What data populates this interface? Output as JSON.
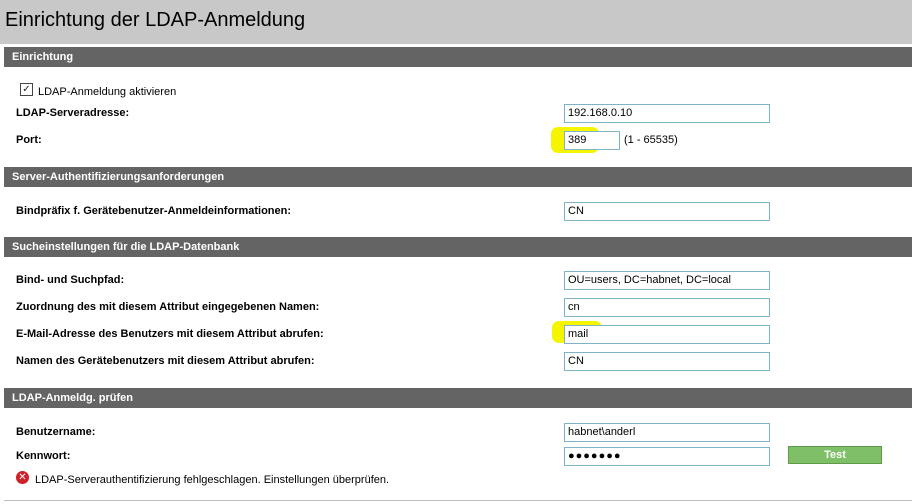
{
  "page": {
    "title": "Einrichtung der LDAP-Anmeldung"
  },
  "sections": {
    "setup": "Einrichtung",
    "server_auth": "Server-Authentifizierungsanforderungen",
    "search": "Sucheinstellungen für die LDAP-Datenbank",
    "test": "LDAP-Anmeldg. prüfen"
  },
  "setup": {
    "enable_label": "LDAP-Anmeldung aktivieren",
    "enable_checked": true,
    "server_label": "LDAP-Serveradresse:",
    "server_value": "192.168.0.10",
    "port_label": "Port:",
    "port_value": "389",
    "port_range": "(1 - 65535)"
  },
  "server_auth": {
    "bind_prefix_label": "Bindpräfix f. Gerätebenutzer-Anmeldeinformationen:",
    "bind_prefix_value": "CN"
  },
  "search": {
    "path_label": "Bind- und Suchpfad:",
    "path_value": "OU=users, DC=habnet, DC=local",
    "name_attr_label": "Zuordnung des mit diesem Attribut eingegebenen Namen:",
    "name_attr_value": "cn",
    "email_attr_label": "E-Mail-Adresse des Benutzers mit diesem Attribut abrufen:",
    "email_attr_value": "mail",
    "device_user_label": "Namen des Gerätebenutzers mit diesem Attribut abrufen:",
    "device_user_value": "CN"
  },
  "test": {
    "username_label": "Benutzername:",
    "username_value": "habnet\\anderl",
    "password_label": "Kennwort:",
    "password_value": "●●●●●●●",
    "test_button": "Test",
    "error_message": "LDAP-Serverauthentifizierung fehlgeschlagen. Einstellungen überprüfen."
  },
  "colors": {
    "section_header_bg": "#646464",
    "titlebar_bg": "#c8c8c8",
    "highlight": "#f5f500",
    "test_button_bg": "#7fbf68",
    "error_icon": "#d0202a"
  },
  "icons": {
    "checkbox": "check-icon",
    "error": "error-x-icon"
  }
}
